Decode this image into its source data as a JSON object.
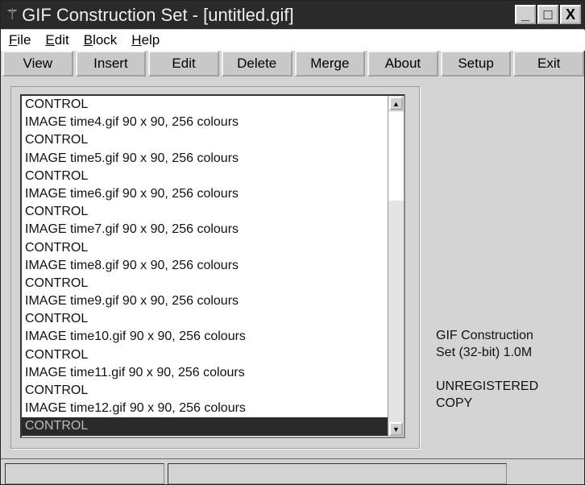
{
  "window": {
    "title": "GIF Construction Set - [untitled.gif]",
    "controls": [
      "_",
      "□",
      "X"
    ]
  },
  "menu": [
    "File",
    "Edit",
    "Block",
    "Help"
  ],
  "toolbar": [
    "View",
    "Insert",
    "Edit",
    "Delete",
    "Merge",
    "About",
    "Setup",
    "Exit"
  ],
  "list": {
    "items": [
      "CONTROL",
      "IMAGE time4.gif 90 x 90, 256 colours",
      "CONTROL",
      "IMAGE time5.gif 90 x 90, 256 colours",
      "CONTROL",
      "IMAGE time6.gif 90 x 90, 256 colours",
      "CONTROL",
      "IMAGE time7.gif 90 x 90, 256 colours",
      "CONTROL",
      "IMAGE time8.gif 90 x 90, 256 colours",
      "CONTROL",
      "IMAGE time9.gif 90 x 90, 256 colours",
      "CONTROL",
      "IMAGE time10.gif 90 x 90, 256 colours",
      "CONTROL",
      "IMAGE time11.gif 90 x 90, 256 colours",
      "CONTROL",
      "IMAGE time12.gif 90 x 90, 256 colours",
      "CONTROL"
    ],
    "selected_index": 18
  },
  "info": {
    "line1": "GIF Construction",
    "line2": "Set (32-bit) 1.0M",
    "line3": "UNREGISTERED",
    "line4": "COPY"
  }
}
